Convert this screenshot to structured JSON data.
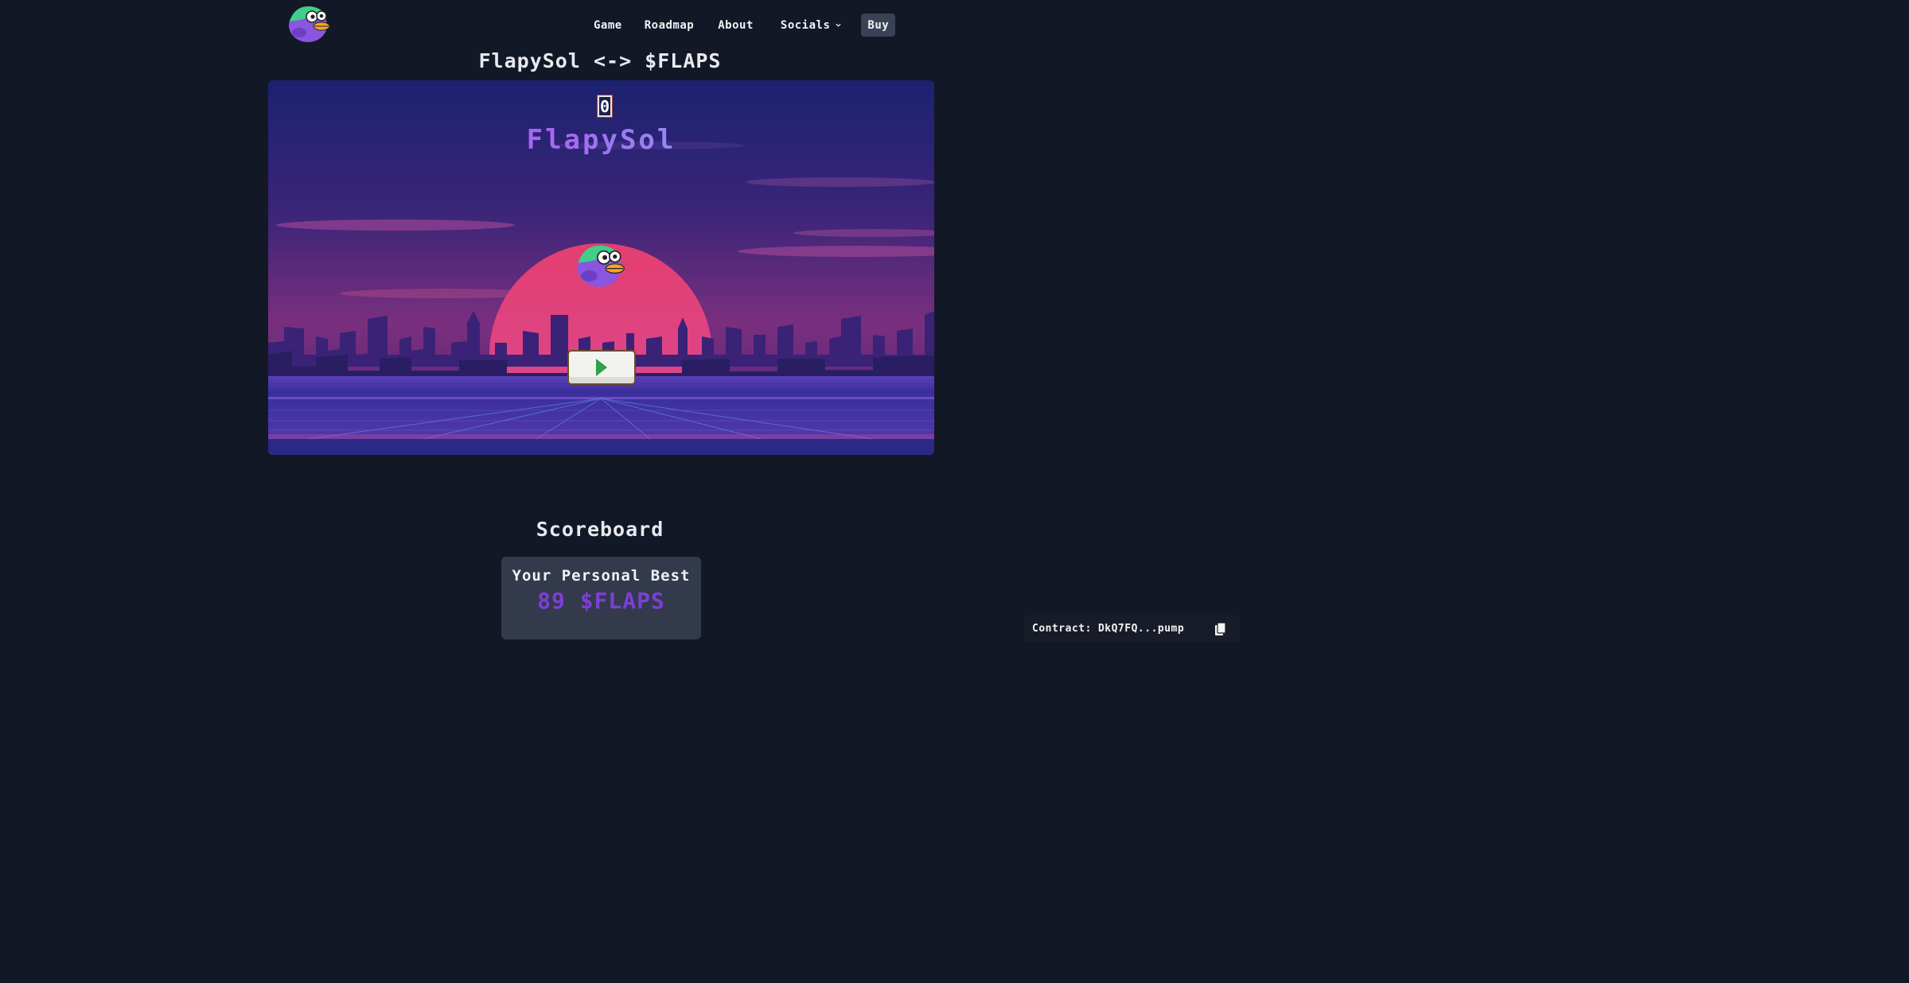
{
  "nav": {
    "logo": "flapysol-bird-logo",
    "links": [
      "Game",
      "Roadmap",
      "About",
      "Socials"
    ],
    "buy_label": "Buy"
  },
  "page_title": "FlapySol <-> $FLAPS",
  "game": {
    "score": "0",
    "logo_text": "FlapySol",
    "play_icon": "play-icon"
  },
  "scoreboard": {
    "title": "Scoreboard",
    "personal_best_label": "Your Personal Best",
    "personal_best_value": "89 $FLAPS"
  },
  "contract": {
    "label": "Contract:",
    "value": "DkQ7FQ...pump",
    "icon": "copy-icon"
  },
  "colors": {
    "page_bg": "#131826",
    "accent_purple": "#7b3fd6",
    "sky_top": "#1d2370",
    "sun": "#e0487a"
  }
}
